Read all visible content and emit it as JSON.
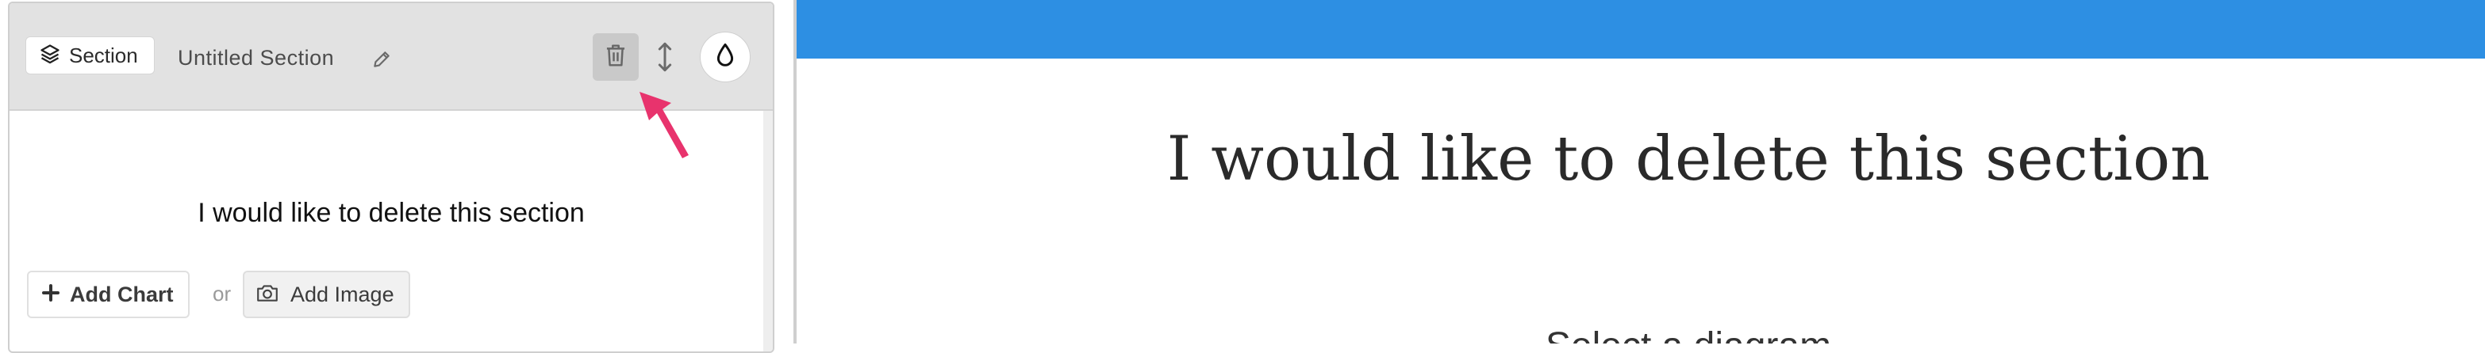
{
  "editor": {
    "section_badge_label": "Section",
    "section_title": "Untitled Section",
    "section_text": "I would like to delete this section",
    "add_chart_label": "Add Chart",
    "or_label": "or",
    "add_image_label": "Add Image",
    "icons": [
      "layers-icon",
      "pencil-icon",
      "trash-icon",
      "move-vertical-icon",
      "droplet-icon",
      "plus-icon",
      "camera-icon"
    ],
    "annotation_arrow_color": "#e8336d"
  },
  "preview": {
    "header_color": "#2d8fe3",
    "heading": "I would like to delete this section",
    "subtext": "Select a diagram"
  }
}
